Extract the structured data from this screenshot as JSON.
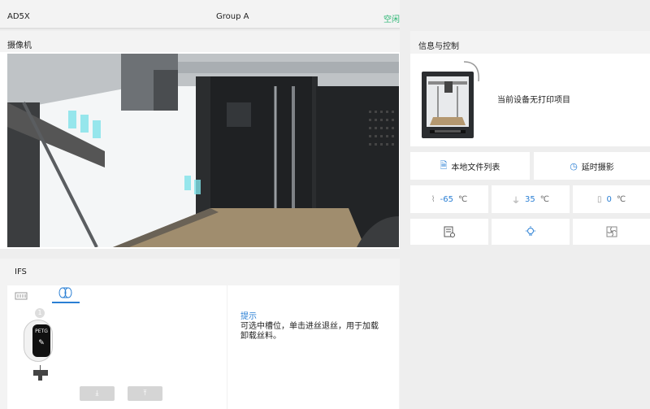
{
  "header": {
    "device_name": "AD5X",
    "group": "Group A",
    "status": "空闲",
    "status_color": "#2bb673"
  },
  "camera": {
    "title": "摄像机"
  },
  "ifs": {
    "title": "IFS",
    "tabs": [
      "slots-tab",
      "filament-tab"
    ],
    "active_tab": 1,
    "slot": {
      "number": "1",
      "material": "PETG"
    },
    "hint_title": "提示",
    "hint_text_line1": "可选中槽位，单击进丝退丝，用于加载",
    "hint_text_line2": "卸载丝料。"
  },
  "info": {
    "title": "信息与控制",
    "idle_text": "当前设备无打印项目",
    "local_files": "本地文件列表",
    "timelapse": "延时摄影",
    "temps": [
      {
        "icon": "nozzle-icon",
        "value": "-65",
        "unit": "℃"
      },
      {
        "icon": "bed-icon",
        "value": "35",
        "unit": "℃"
      },
      {
        "icon": "chamber-icon",
        "value": "0",
        "unit": "℃"
      }
    ],
    "controls": [
      "print-settings-icon",
      "light-icon",
      "fan-icon"
    ]
  },
  "colors": {
    "accent": "#2a7fd4",
    "ok": "#2bb673"
  }
}
